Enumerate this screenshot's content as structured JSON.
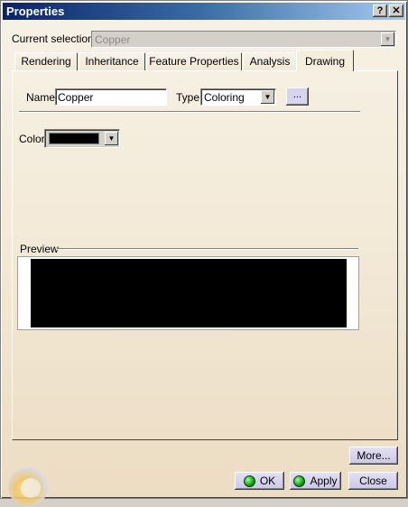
{
  "window": {
    "title": "Properties",
    "help_button": "?",
    "close_button": "✕"
  },
  "current_selection": {
    "label": "Current selection :",
    "value": "Copper"
  },
  "tabs": [
    {
      "label": "Rendering"
    },
    {
      "label": "Inheritance"
    },
    {
      "label": "Feature Properties"
    },
    {
      "label": "Analysis"
    },
    {
      "label": "Drawing",
      "active": true
    }
  ],
  "drawing": {
    "name_label": "Name:",
    "name_value": "Copper",
    "type_label": "Type:",
    "type_value": "Coloring",
    "ellipsis_button": "...",
    "color_label": "Color:",
    "color_value": "#000000",
    "preview_label": "Preview",
    "preview_color": "#000000"
  },
  "footer": {
    "more_label": "More...",
    "ok_label": "OK",
    "apply_label": "Apply",
    "close_label": "Close"
  },
  "colors": {
    "titlebar_start": "#0a246a",
    "titlebar_end": "#a6caf0",
    "ok_indicator": "#129a12"
  },
  "icons": {
    "ok": "green-led-icon",
    "apply": "green-led-icon",
    "dropdown": "chevron-down-icon",
    "corner": "globe-icon"
  }
}
